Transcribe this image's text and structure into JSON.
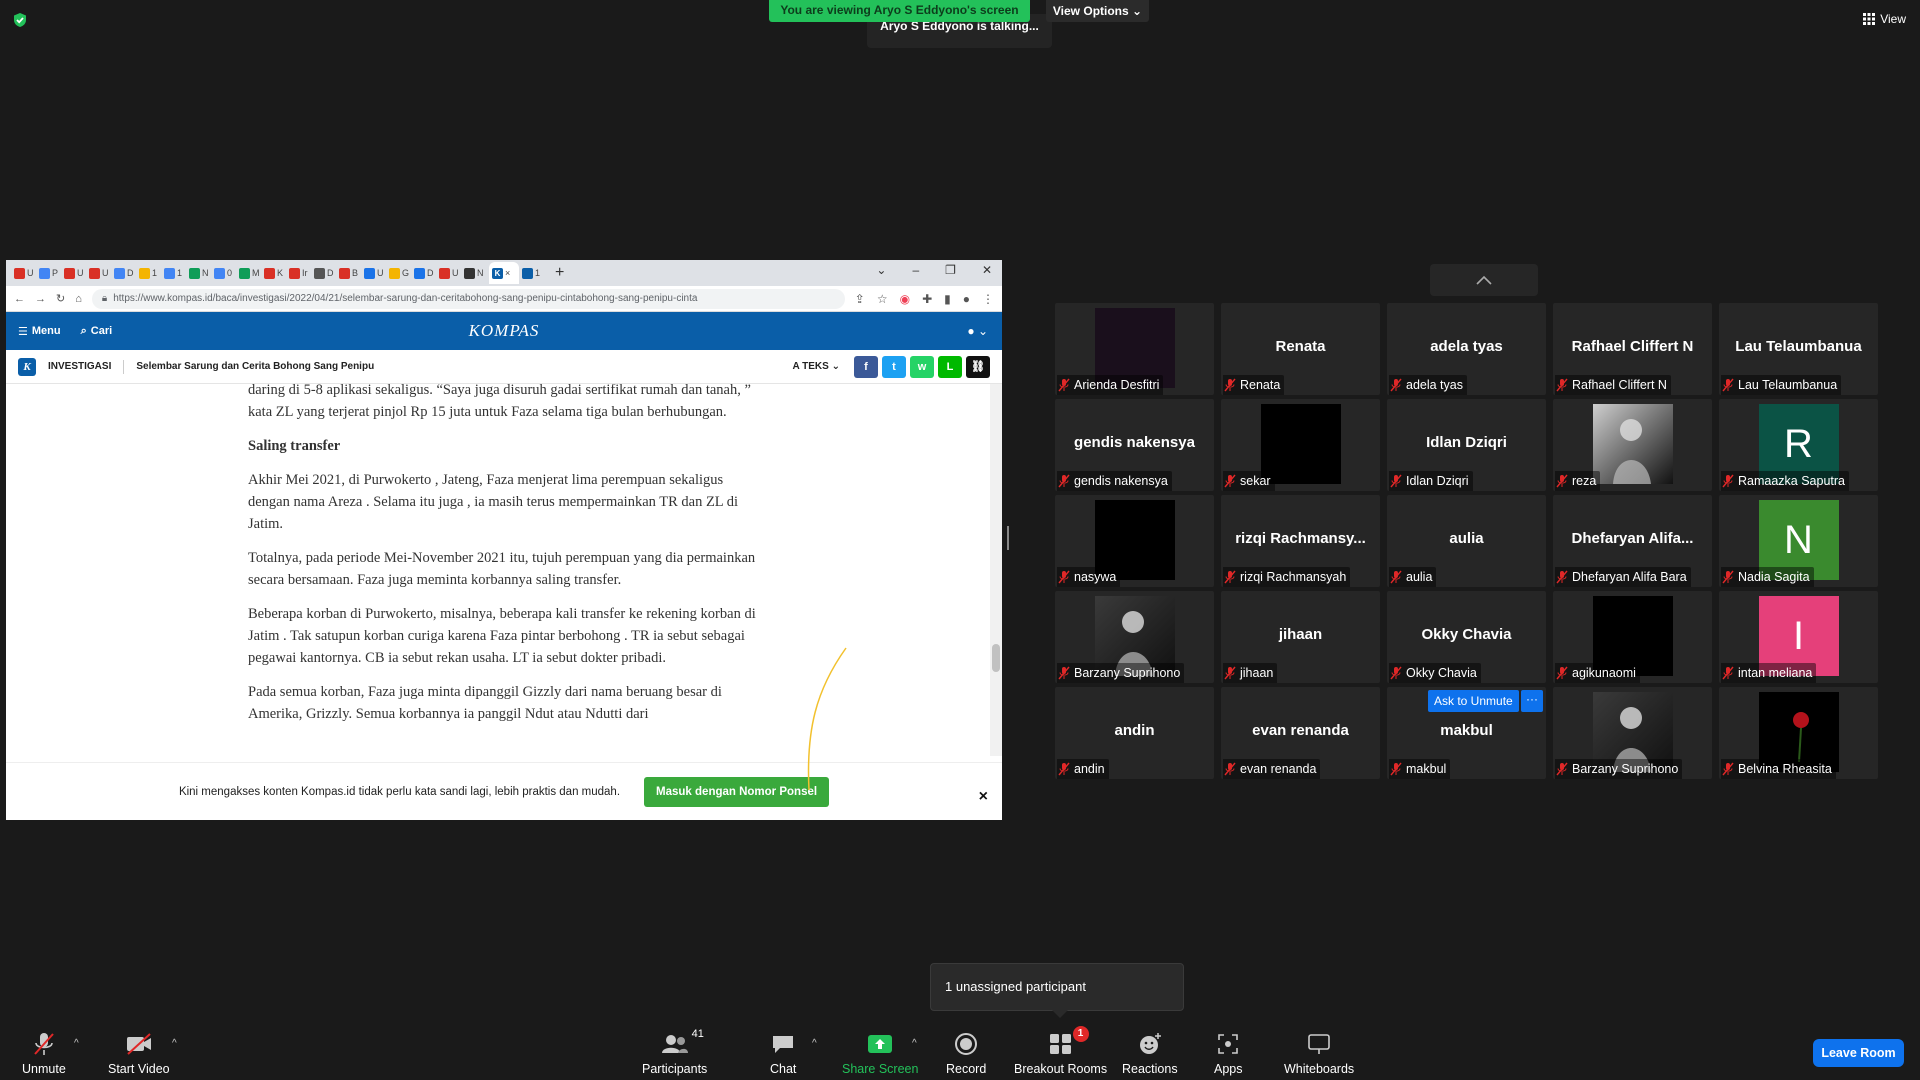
{
  "banner": {
    "viewing": "You are viewing Aryo S Eddyono's screen",
    "view_options": "View Options",
    "talking": "Aryo S Eddyono is talking...",
    "top_right_view": "View"
  },
  "browser": {
    "tabs": [
      {
        "letter": "U",
        "color": "#d93025"
      },
      {
        "letter": "P",
        "color": "#4285f4"
      },
      {
        "letter": "U",
        "color": "#d93025"
      },
      {
        "letter": "U",
        "color": "#d93025"
      },
      {
        "letter": "D",
        "color": "#4285f4"
      },
      {
        "letter": "1",
        "color": "#f4b400"
      },
      {
        "letter": "1",
        "color": "#4285f4"
      },
      {
        "letter": "N",
        "color": "#0f9d58"
      },
      {
        "letter": "0",
        "color": "#4285f4"
      },
      {
        "letter": "M",
        "color": "#0f9d58"
      },
      {
        "letter": "K",
        "color": "#d93025"
      },
      {
        "letter": "Ir",
        "color": "#d93025"
      },
      {
        "letter": "D",
        "color": "#555555"
      },
      {
        "letter": "B",
        "color": "#d93025"
      },
      {
        "letter": "U",
        "color": "#1a73e8"
      },
      {
        "letter": "G",
        "color": "#f4b400"
      },
      {
        "letter": "D",
        "color": "#1a73e8"
      },
      {
        "letter": "U",
        "color": "#d93025"
      },
      {
        "letter": "N",
        "color": "#333333"
      }
    ],
    "active_tab_letter": "K",
    "last_tab": "1",
    "url": "https://www.kompas.id/baca/investigasi/2022/04/21/selembar-sarung-dan-ceritabohong-sang-penipu-cintabohong-sang-penipu-cinta",
    "site": {
      "menu": "Menu",
      "search": "Cari",
      "logo": "KOMPAS",
      "badge": "K",
      "section": "INVESTIGASI",
      "article_title": "Selembar Sarung dan Cerita Bohong Sang Penipu",
      "text_size": "TEKS"
    },
    "article": {
      "p1": "daring di 5-8 aplikasi sekaligus. “Saya juga disuruh gadai sertifikat rumah dan tanah, ” kata ZL yang terjerat pinjol Rp 15 juta untuk Faza selama tiga bulan berhubungan.",
      "h1": "Saling transfer",
      "p2": "Akhir Mei 2021, di Purwokerto , Jateng, Faza menjerat lima perempuan sekaligus dengan nama Areza . Selama itu juga , ia masih terus mempermainkan TR dan ZL di Jatim.",
      "p3": "Totalnya, pada periode Mei-November 2021 itu, tujuh perempuan yang dia permainkan secara bersamaan. Faza juga meminta korbannya saling transfer.",
      "p4": "Beberapa korban di Purwokerto, misalnya, beberapa kali transfer ke rekening korban di Jatim . Tak satupun korban curiga karena Faza pintar berbohong . TR ia sebut sebagai pegawai kantornya. CB ia sebut rekan usaha. LT ia sebut dokter pribadi.",
      "p5": "Pada semua korban, Faza juga minta dipanggil Gizzly dari nama beruang besar di Amerika, Grizzly. Semua korbannya ia panggil Ndut atau Ndutti dari"
    },
    "login_prompt": "Kini mengakses konten Kompas.id tidak perlu kata sandi lagi, lebih praktis dan mudah.",
    "login_button": "Masuk dengan Nomor Ponsel",
    "close": "×"
  },
  "participants": [
    {
      "center": "",
      "label": "Arienda Desfitri",
      "kind": "video",
      "bg": "#1a0f1c"
    },
    {
      "center": "Renata",
      "label": "Renata",
      "kind": "name"
    },
    {
      "center": "adela tyas",
      "label": "adela tyas",
      "kind": "name"
    },
    {
      "center": "Rafhael Cliffert N",
      "label": "Rafhael Cliffert N",
      "kind": "name"
    },
    {
      "center": "Lau Telaumbanua",
      "label": "Lau Telaumbanua",
      "kind": "name"
    },
    {
      "center": "gendis nakensya",
      "label": "gendis nakensya",
      "kind": "name"
    },
    {
      "center": "",
      "label": "sekar",
      "kind": "video",
      "bg": "#000000"
    },
    {
      "center": "Idlan Dziqri",
      "label": "Idlan Dziqri",
      "kind": "name"
    },
    {
      "center": "",
      "label": "reza",
      "kind": "photo",
      "bg": "#cfcfcf"
    },
    {
      "center": "R",
      "label": "Ramaazka Saputra",
      "kind": "letter",
      "bg": "#0b5345"
    },
    {
      "center": "",
      "label": "nasywa",
      "kind": "video",
      "bg": "#000000"
    },
    {
      "center": "rizqi  Rachmansy...",
      "label": "rizqi Rachmansyah",
      "kind": "name"
    },
    {
      "center": "aulia",
      "label": "aulia",
      "kind": "name"
    },
    {
      "center": "Dhefaryan  Alifa...",
      "label": "Dhefaryan Alifa Bara",
      "kind": "name"
    },
    {
      "center": "N",
      "label": "Nadia Sagita",
      "kind": "letter",
      "bg": "#3a8a2e"
    },
    {
      "center": "",
      "label": "Barzany Suprihono",
      "kind": "photo",
      "bg": "#3a3a3a"
    },
    {
      "center": "jihaan",
      "label": "jihaan",
      "kind": "name"
    },
    {
      "center": "Okky Chavia",
      "label": "Okky Chavia",
      "kind": "name"
    },
    {
      "center": "",
      "label": "agikunaomi",
      "kind": "video",
      "bg": "#000000"
    },
    {
      "center": "I",
      "label": "intan meliana",
      "kind": "letter",
      "bg": "#e5407a"
    },
    {
      "center": "andin",
      "label": "andin",
      "kind": "name"
    },
    {
      "center": "evan renanda",
      "label": "evan renanda",
      "kind": "name"
    },
    {
      "center": "makbul",
      "label": "makbul",
      "kind": "name"
    },
    {
      "center": "",
      "label": "Barzany Suprihono",
      "kind": "photo",
      "bg": "#3a3a3a"
    },
    {
      "center": "",
      "label": "Belvina Rheasita",
      "kind": "rose",
      "bg": "#000000"
    }
  ],
  "ask_to_unmute": "Ask to Unmute",
  "ask_more": "···",
  "tooltip": "1 unassigned participant",
  "toolbar": {
    "unmute": "Unmute",
    "start_video": "Start Video",
    "participants": "Participants",
    "participants_count": "41",
    "chat": "Chat",
    "share_screen": "Share Screen",
    "record": "Record",
    "breakout_rooms": "Breakout Rooms",
    "breakout_badge": "1",
    "reactions": "Reactions",
    "apps": "Apps",
    "whiteboards": "Whiteboards",
    "leave": "Leave Room"
  },
  "colors": {
    "accent_green": "#23c15a",
    "zoom_blue": "#0e72ed",
    "kompas_blue": "#0a5ea8",
    "muted_red": "#e02828"
  }
}
